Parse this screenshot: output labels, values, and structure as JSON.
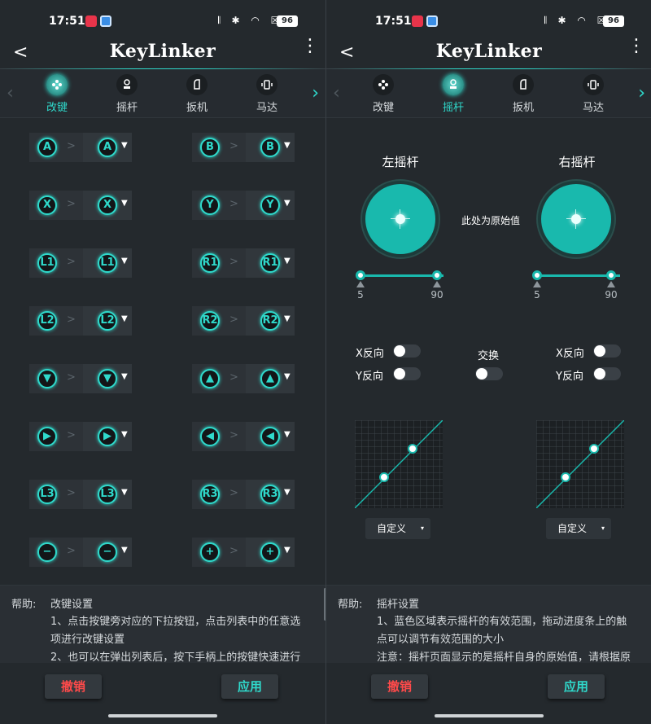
{
  "status": {
    "time": "17:51",
    "battery": "96",
    "icons": "𝄃 ✱ ◠ ☒"
  },
  "app": {
    "title": "KeyLinker",
    "back": "<",
    "more": "⋮"
  },
  "tabs": [
    {
      "label": "改键",
      "icon": "gamepad-icon"
    },
    {
      "label": "摇杆",
      "icon": "joystick-icon"
    },
    {
      "label": "扳机",
      "icon": "trigger-icon"
    },
    {
      "label": "马达",
      "icon": "vibration-motor-icon"
    }
  ],
  "nav": {
    "prev": "‹",
    "next": "›"
  },
  "keys": {
    "chev": ">",
    "drop": "▼",
    "rows": [
      [
        {
          "src": "A",
          "dst": "A"
        },
        {
          "src": "B",
          "dst": "B"
        }
      ],
      [
        {
          "src": "X",
          "dst": "X"
        },
        {
          "src": "Y",
          "dst": "Y"
        }
      ],
      [
        {
          "src": "L1",
          "dst": "L1"
        },
        {
          "src": "R1",
          "dst": "R1"
        }
      ],
      [
        {
          "src": "L2",
          "dst": "L2"
        },
        {
          "src": "R2",
          "dst": "R2"
        }
      ],
      [
        {
          "src": "▼",
          "dst": "▼"
        },
        {
          "src": "▲",
          "dst": "▲"
        }
      ],
      [
        {
          "src": "▶",
          "dst": "▶"
        },
        {
          "src": "◀",
          "dst": "◀"
        }
      ],
      [
        {
          "src": "L3",
          "dst": "L3"
        },
        {
          "src": "R3",
          "dst": "R3"
        }
      ],
      [
        {
          "src": "−",
          "dst": "−"
        },
        {
          "src": "+",
          "dst": "+"
        }
      ]
    ]
  },
  "left_help": {
    "label": "帮助:",
    "title": "改键设置",
    "lines": [
      "1、点击按键旁对应的下拉按钮，点击列表中的任意选",
      "项进行改键设置",
      "2、也可以在弹出列表后，按下手柄上的按键快速进行"
    ]
  },
  "right_help": {
    "label": "帮助:",
    "title": "摇杆设置",
    "lines": [
      "1、蓝色区域表示摇杆的有效范围，拖动进度条上的触",
      "点可以调节有效范围的大小",
      "注意：摇杆页面显示的是摇杆自身的原始值，请根据原"
    ]
  },
  "buttons": {
    "cancel": "撤销",
    "apply": "应用"
  },
  "sticks": {
    "left_label": "左摇杆",
    "right_label": "右摇杆",
    "original_note": "此处为原始值",
    "left_range": {
      "min": "5",
      "max": "90"
    },
    "right_range": {
      "min": "5",
      "max": "90"
    }
  },
  "toggles": {
    "x_invert": "X反向",
    "y_invert": "Y反向",
    "swap": "交换"
  },
  "curve": {
    "preset": "自定义",
    "arrow": "▾"
  },
  "colors": {
    "accent": "#2fd9cb",
    "stick_fill": "#19b9ad",
    "cancel": "#ff4a4a",
    "panel": "#24292d"
  }
}
